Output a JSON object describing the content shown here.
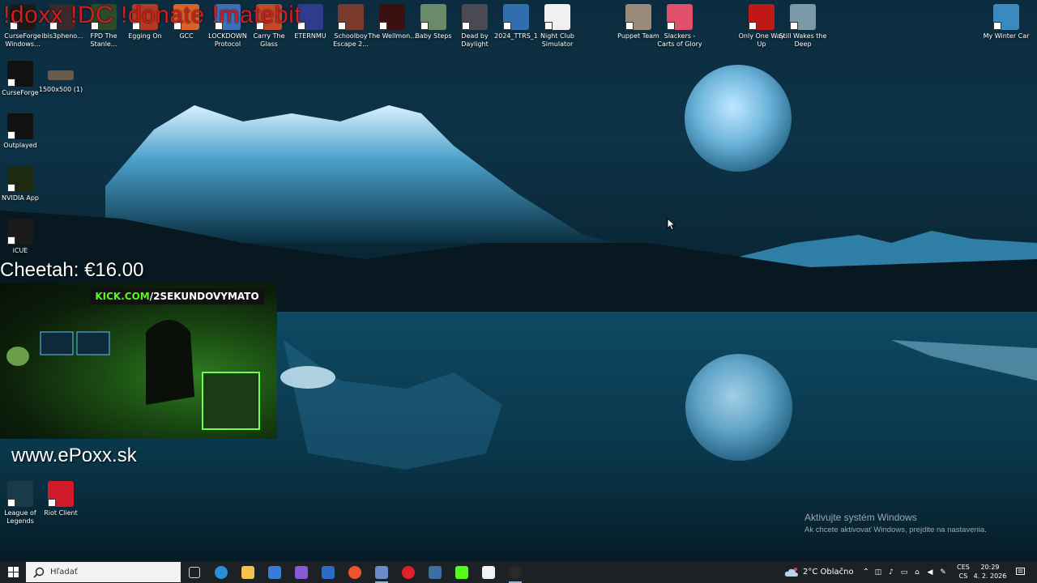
{
  "overlay": {
    "top_banner": "!doxx !DC !donate !matebit",
    "donation": "Cheetah: €16.00",
    "kick_prefix": "KICK.COM",
    "kick_suffix": "/2SEKUNDOVYMATO",
    "website": "www.ePoxx.sk"
  },
  "desktop_top_icons": [
    {
      "label": "CurseForge Windows...",
      "color": "#1a1a1a",
      "icon": "curseforge-icon"
    },
    {
      "label": "ibis3pheno...",
      "color": "#3a2a2a",
      "icon": "app-icon"
    },
    {
      "label": "FPD The Stanle...",
      "color": "#2f4a2a",
      "icon": "game-icon"
    },
    {
      "label": "Egging On",
      "color": "#b33b20",
      "icon": "game-icon"
    },
    {
      "label": "GCC",
      "color": "#d9632a",
      "icon": "game-icon"
    },
    {
      "label": "LOCKDOWN Protocol",
      "color": "#3d6fb6",
      "icon": "game-icon"
    },
    {
      "label": "Carry The Glass",
      "color": "#c24a2a",
      "icon": "game-icon"
    },
    {
      "label": "ETERNMU",
      "color": "#2f3b8c",
      "icon": "game-icon"
    },
    {
      "label": "Schoolboy Escape 2...",
      "color": "#7a3b2a",
      "icon": "game-icon"
    },
    {
      "label": "The Wellmon...",
      "color": "#3a1010",
      "icon": "game-icon"
    },
    {
      "label": "Baby Steps",
      "color": "#6a8a6a",
      "icon": "game-icon"
    },
    {
      "label": "Dead by Daylight",
      "color": "#4a4a55",
      "icon": "game-icon"
    },
    {
      "label": "2024_TTRS_1",
      "color": "#2f6fb0",
      "icon": "game-icon"
    },
    {
      "label": "Night Club Simulator",
      "color": "#f0f0f0",
      "icon": "game-icon"
    },
    {
      "label": "Puppet Team",
      "color": "#9a8a7a",
      "icon": "game-icon"
    },
    {
      "label": "Slackers - Carts of Glory",
      "color": "#e0506a",
      "icon": "game-icon"
    },
    {
      "label": "Only One Way Up",
      "color": "#c01818",
      "icon": "game-icon"
    },
    {
      "label": "Still Wakes the Deep",
      "color": "#7a9aa8",
      "icon": "game-icon"
    },
    {
      "label": "My Winter Car",
      "color": "#3a8ac0",
      "icon": "game-icon"
    }
  ],
  "desktop_left_icons": [
    {
      "label": "CurseForge",
      "color": "#111111",
      "icon": "curseforge-icon"
    },
    {
      "label": "1500x500 (1)",
      "color": "#6a5a4a",
      "icon": "image-file-icon"
    },
    {
      "label": "Outplayed",
      "color": "#111111",
      "icon": "outplayed-icon"
    },
    {
      "label": "NVIDIA App",
      "color": "#1e2a10",
      "icon": "nvidia-icon"
    },
    {
      "label": "iCUE",
      "color": "#1a1a1a",
      "icon": "icue-icon"
    },
    {
      "label": "League of Legends",
      "color": "#1a3a4a",
      "icon": "league-icon"
    },
    {
      "label": "Riot Client",
      "color": "#d01c2a",
      "icon": "riot-icon"
    }
  ],
  "watermark": {
    "title": "Aktivujte systém Windows",
    "subtitle": "Ak chcete aktivovať Windows, prejdite na nastavenia."
  },
  "taskbar": {
    "search_placeholder": "Hľadať",
    "apps": [
      {
        "name": "task-view-icon",
        "color": "#cfd6dd"
      },
      {
        "name": "edge-icon",
        "color": "#2a8fd6"
      },
      {
        "name": "file-explorer-icon",
        "color": "#f2c14e"
      },
      {
        "name": "store-icon",
        "color": "#3a7bd5"
      },
      {
        "name": "copilot-icon",
        "color": "#8a5ad6"
      },
      {
        "name": "mail-icon",
        "color": "#2b6cc4"
      },
      {
        "name": "brave-icon",
        "color": "#f0542d"
      },
      {
        "name": "app-icon",
        "color": "#6a8ac8"
      },
      {
        "name": "opera-icon",
        "color": "#e0202a"
      },
      {
        "name": "steam-icon",
        "color": "#3a6ea5"
      },
      {
        "name": "kick-icon",
        "color": "#53fc18"
      },
      {
        "name": "obs-icon",
        "color": "#f2f2f2"
      },
      {
        "name": "obs-studio-icon",
        "color": "#2a2a2a"
      }
    ],
    "weather": "2°C  Oblačno",
    "lang_top": "CES",
    "lang_bottom": "CS",
    "time": "20:29",
    "date": "4. 2. 2026"
  }
}
